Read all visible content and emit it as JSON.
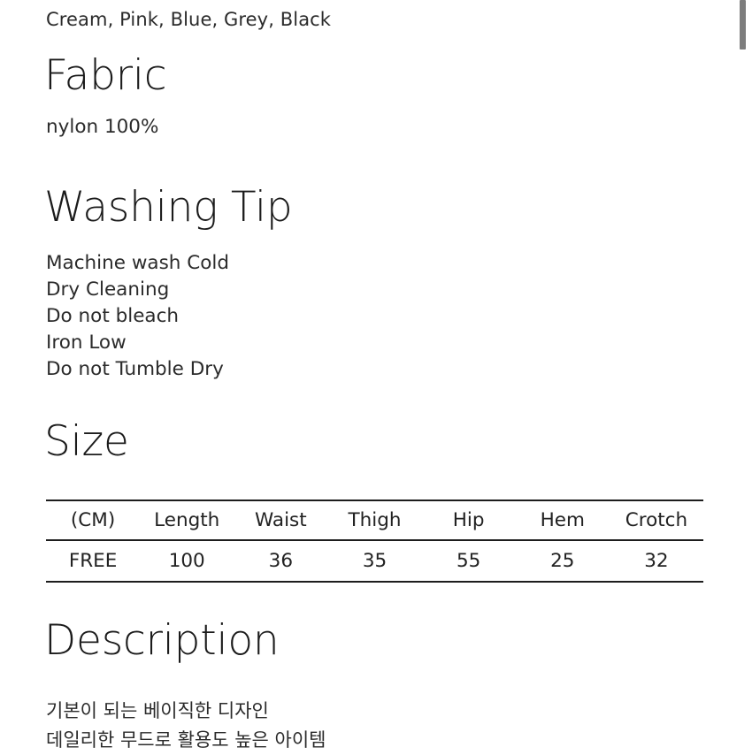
{
  "product": {
    "colors_line": "Cream, Pink, Blue, Grey, Black",
    "sections": {
      "fabric": {
        "heading": "Fabric",
        "body": "nylon 100%"
      },
      "washing_tip": {
        "heading": "Washing Tip",
        "lines": [
          "Machine wash Cold",
          "Dry Cleaning",
          "Do not bleach",
          "Iron Low",
          "Do not Tumble Dry"
        ],
        "body": "Machine wash Cold\nDry Cleaning\nDo not bleach\nIron Low\nDo not Tumble Dry"
      },
      "size": {
        "heading": "Size",
        "table": {
          "headers": [
            "(CM)",
            "Length",
            "Waist",
            "Thigh",
            "Hip",
            "Hem",
            "Crotch"
          ],
          "rows": [
            [
              "FREE",
              "100",
              "36",
              "35",
              "55",
              "25",
              "32"
            ]
          ]
        }
      },
      "description": {
        "heading": "Description",
        "lines": [
          "기본이 되는 베이직한 디자인",
          "데일리한 무드로 활용도 높은 아이템"
        ],
        "body": "기본이 되는 베이직한 디자인\n데일리한 무드로 활용도 높은 아이템"
      }
    }
  },
  "scrollbar": {
    "name": "vertical-scrollbar",
    "thumb_color": "#7d7d7d"
  },
  "colors": {
    "background": "#ffffff",
    "heading_text": "#1b1b1b",
    "body_text": "#2b2b2b",
    "rule": "#1d1d1d"
  }
}
